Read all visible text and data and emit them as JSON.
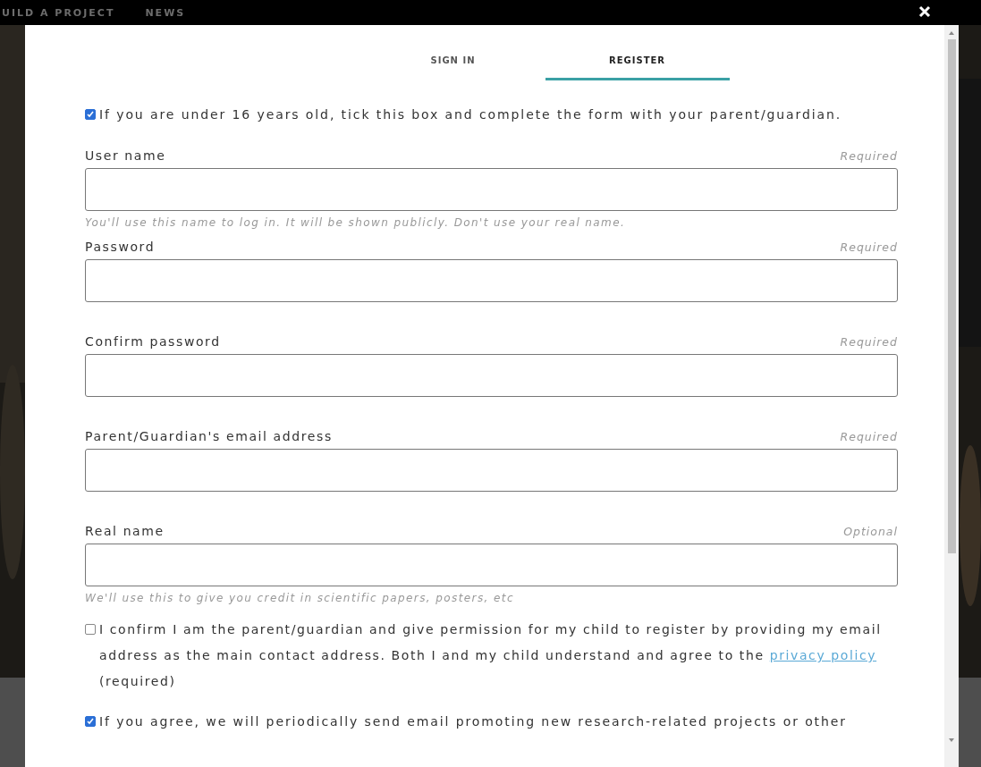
{
  "top_nav": {
    "items": [
      "UILD A PROJECT",
      "NEWS"
    ]
  },
  "tabs": [
    {
      "label": "SIGN IN",
      "selected": false
    },
    {
      "label": "REGISTER",
      "selected": true
    }
  ],
  "under_16": {
    "checked": true,
    "label": "If you are under 16 years old, tick this box and complete the form with your parent/guardian."
  },
  "fields": [
    {
      "label": "User name",
      "note": "Required",
      "hint": "You'll use this name to log in. It will be shown publicly. Don't use your real name."
    },
    {
      "label": "Password",
      "note": "Required"
    },
    {
      "label": "Confirm password",
      "note": "Required"
    },
    {
      "label": "Parent/Guardian's email address",
      "note": "Required"
    },
    {
      "label": "Real name",
      "note": "Optional",
      "hint": "We'll use this to give you credit in scientific papers, posters, etc"
    }
  ],
  "consent": {
    "checked": false,
    "text_before": "I confirm I am the parent/guardian and give permission for my child to register by providing my email address as the main contact address. Both I and my child understand and agree to the",
    "link": "privacy policy",
    "text_after": "(required)"
  },
  "newsletter": {
    "checked": true,
    "label": "If you agree, we will periodically send email promoting new research-related projects or other"
  }
}
